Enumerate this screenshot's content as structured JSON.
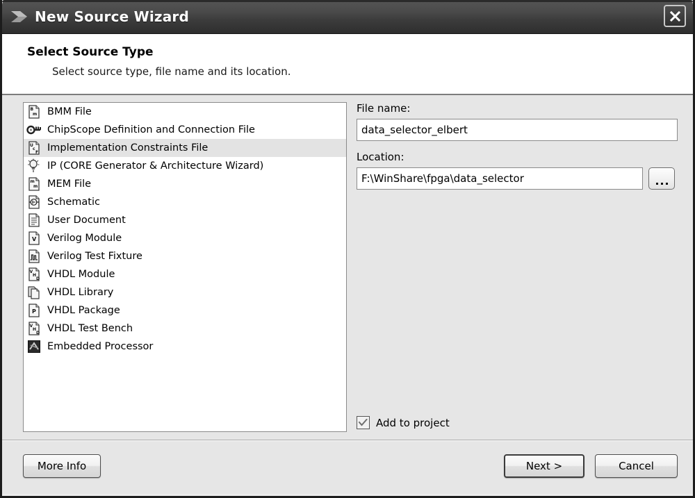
{
  "window": {
    "title": "New Source Wizard",
    "logo_icon": "xilinx-chevron-icon",
    "close_icon": "close-icon",
    "close_label": "Close"
  },
  "header": {
    "title": "Select Source Type",
    "subtitle": "Select source type, file name and its location."
  },
  "source_list": {
    "selected_index": 2,
    "items": [
      {
        "label": "BMM File",
        "icon": "bmm-file-icon"
      },
      {
        "label": "ChipScope Definition and Connection File",
        "icon": "chipscope-key-icon"
      },
      {
        "label": "Implementation Constraints File",
        "icon": "ucf-file-icon"
      },
      {
        "label": "IP (CORE Generator & Architecture Wizard)",
        "icon": "lightbulb-icon"
      },
      {
        "label": "MEM File",
        "icon": "mem-file-icon"
      },
      {
        "label": "Schematic",
        "icon": "schematic-icon"
      },
      {
        "label": "User Document",
        "icon": "document-lines-icon"
      },
      {
        "label": "Verilog Module",
        "icon": "verilog-module-icon"
      },
      {
        "label": "Verilog Test Fixture",
        "icon": "waveform-icon"
      },
      {
        "label": "VHDL Module",
        "icon": "vhdl-module-icon"
      },
      {
        "label": "VHDL Library",
        "icon": "vhdl-library-icon"
      },
      {
        "label": "VHDL Package",
        "icon": "vhdl-package-icon"
      },
      {
        "label": "VHDL Test Bench",
        "icon": "vhdl-testbench-icon"
      },
      {
        "label": "Embedded Processor",
        "icon": "embedded-processor-icon"
      }
    ]
  },
  "form": {
    "file_name_label": "File name:",
    "file_name_value": "data_selector_elbert",
    "file_name_placeholder": "",
    "location_label": "Location:",
    "location_value": "F:\\WinShare\\fpga\\data_selector",
    "location_placeholder": "",
    "browse_label": "...",
    "browse_icon": "ellipsis-icon",
    "add_to_project_label": "Add to project",
    "add_to_project_checked": true,
    "check_icon": "checkmark-icon"
  },
  "footer": {
    "more_info_label": "More Info",
    "next_label": "Next >",
    "cancel_label": "Cancel"
  },
  "colors": {
    "titlebar": "#3c3c3c",
    "body": "#e6e6e6",
    "selection": "#e3e3e3",
    "border": "#8a8a8a"
  }
}
